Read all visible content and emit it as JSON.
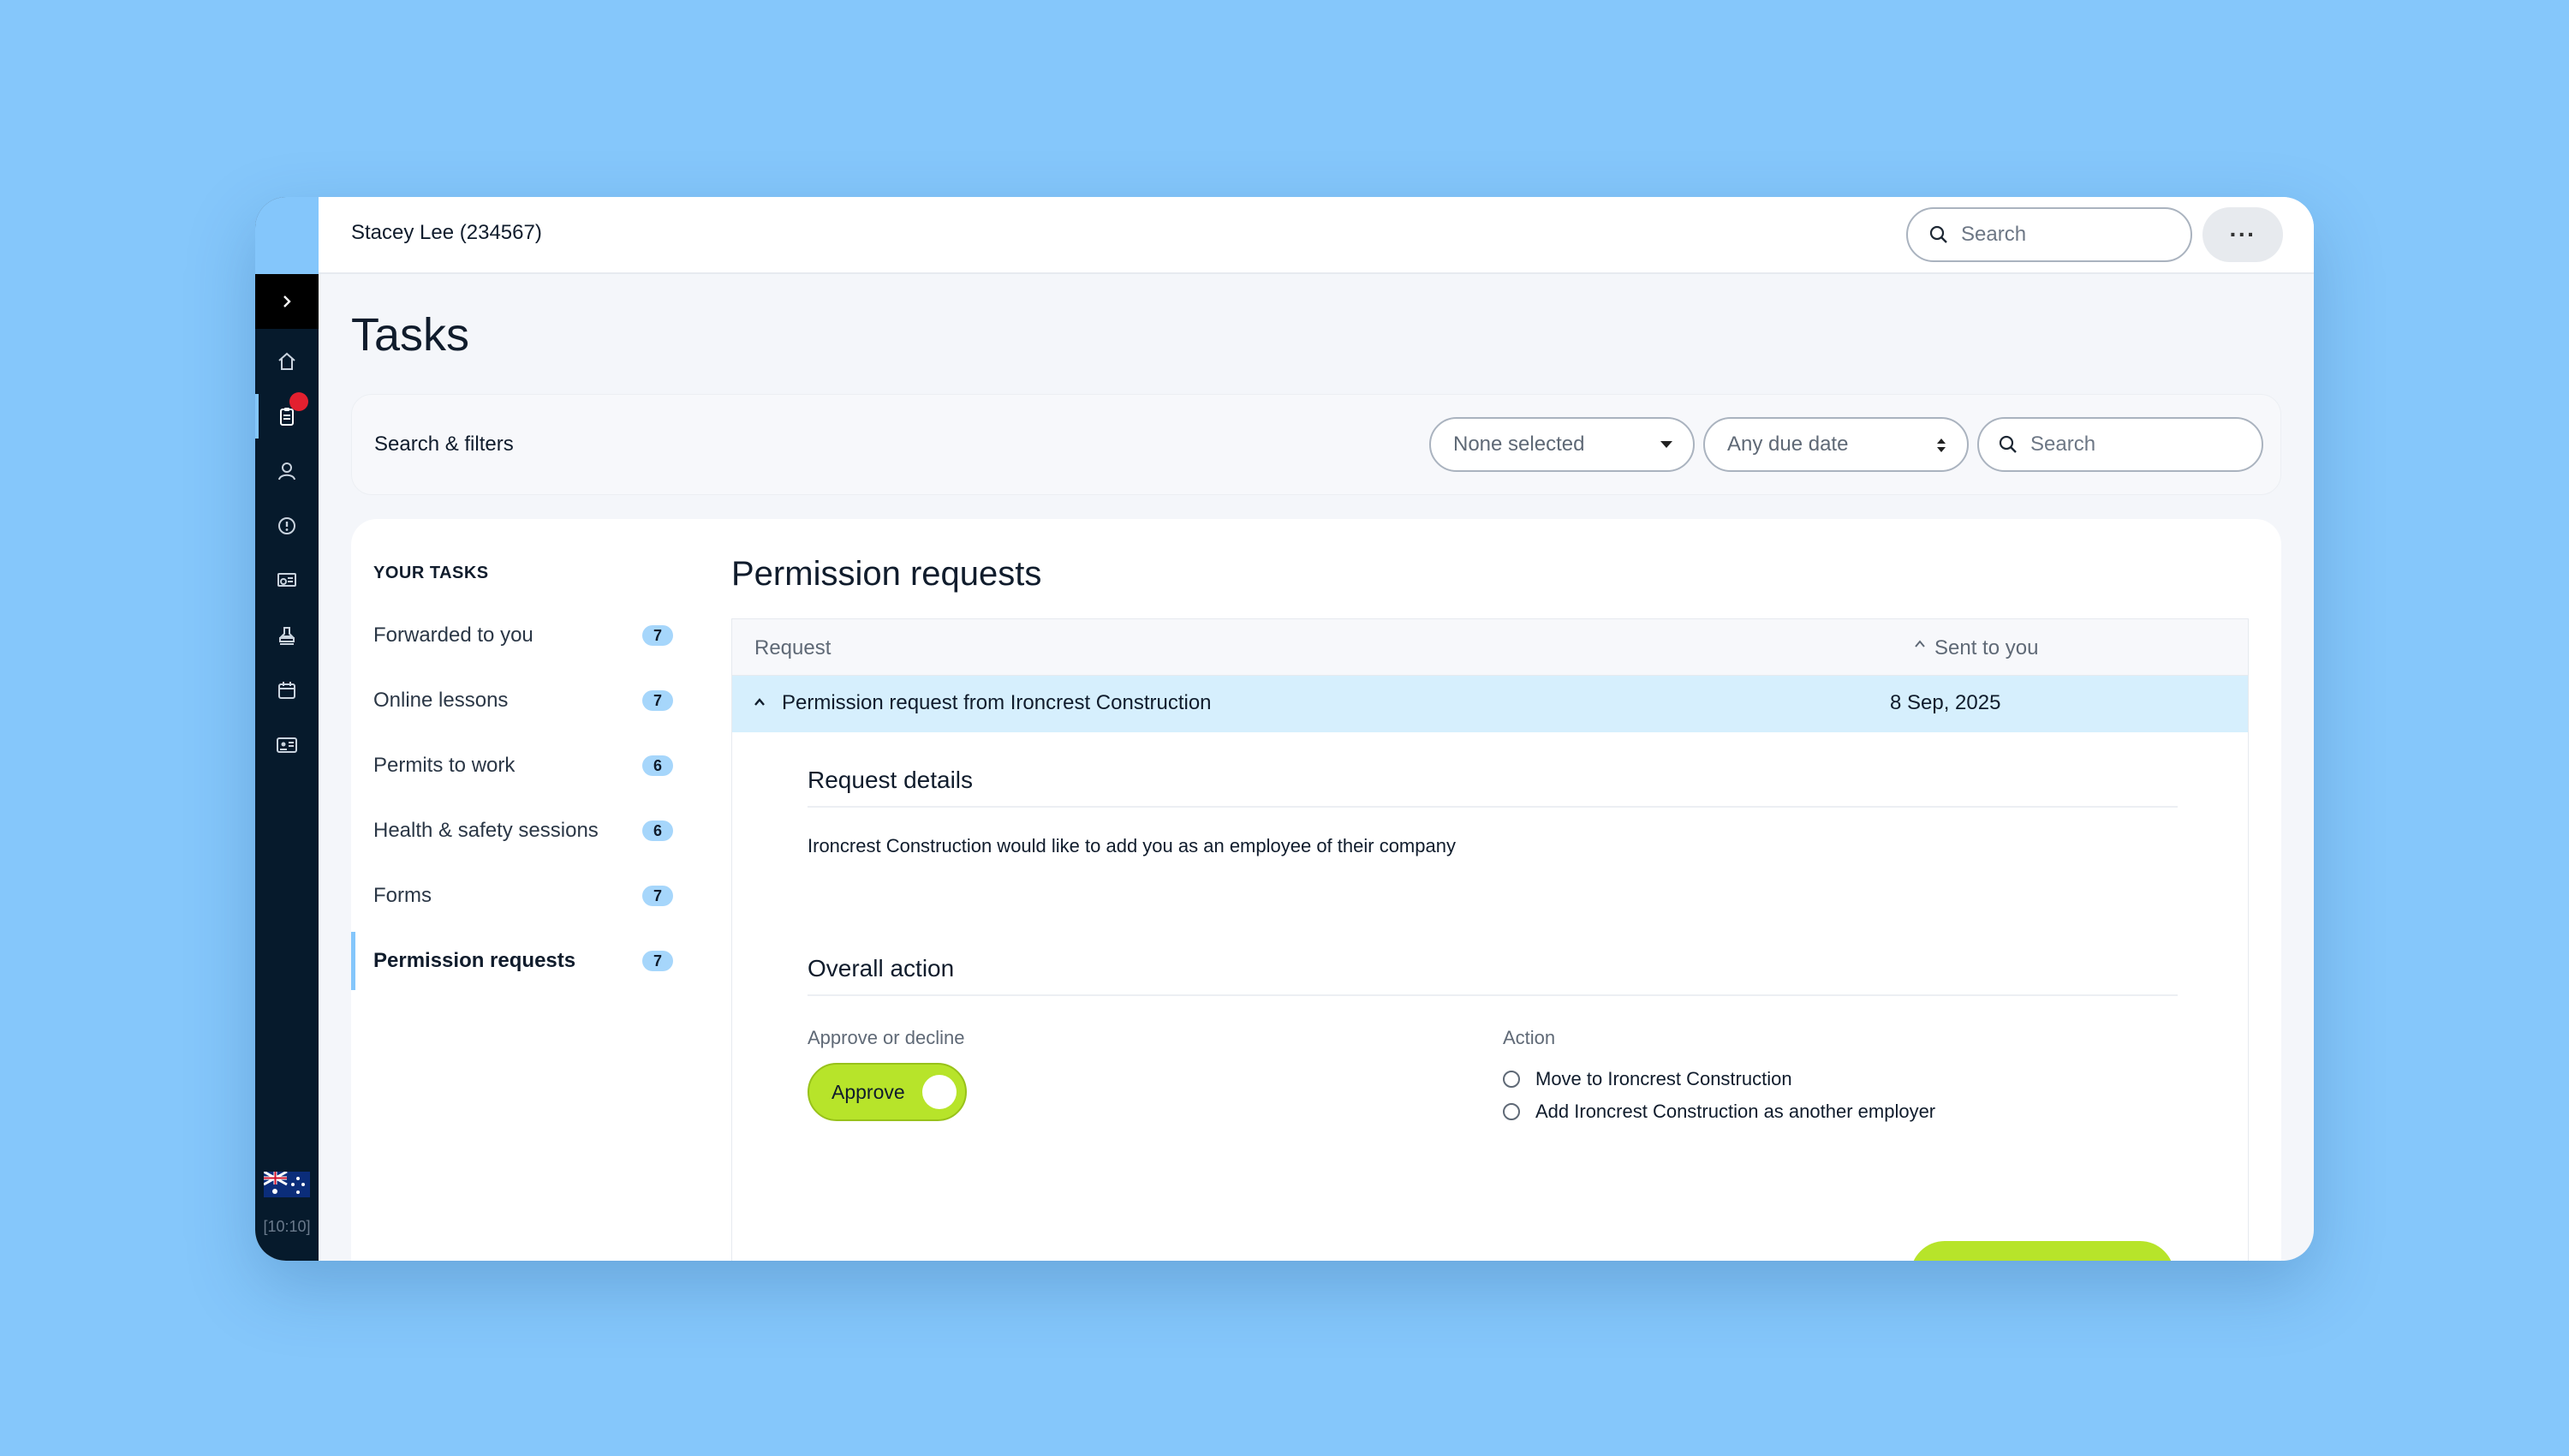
{
  "user": {
    "name": "Stacey Lee (234567)"
  },
  "topbar": {
    "search_placeholder": "Search",
    "more_label": "···"
  },
  "page": {
    "title": "Tasks"
  },
  "filters": {
    "label": "Search & filters",
    "status_select": "None selected",
    "due_date_select": "Any due date",
    "search_placeholder": "Search"
  },
  "sidebar": {
    "icons": [
      "home-icon",
      "clipboard-icon",
      "user-icon",
      "alert-icon",
      "certificate-icon",
      "stamp-icon",
      "calendar-icon",
      "id-card-icon"
    ],
    "active_index": 1,
    "flag": "australia-flag-icon",
    "clock": "[10:10]"
  },
  "tasks": {
    "heading": "YOUR TASKS",
    "items": [
      {
        "label": "Forwarded to you",
        "count": "7"
      },
      {
        "label": "Online lessons",
        "count": "7"
      },
      {
        "label": "Permits to work",
        "count": "6"
      },
      {
        "label": "Health & safety sessions",
        "count": "6"
      },
      {
        "label": "Forms",
        "count": "7"
      },
      {
        "label": "Permission requests",
        "count": "7"
      }
    ],
    "active_index": 5
  },
  "panel": {
    "title": "Permission requests",
    "columns": {
      "request": "Request",
      "sent": "Sent to you"
    },
    "row": {
      "title": "Permission request from Ironcrest Construction",
      "date": "8 Sep, 2025"
    },
    "details": {
      "title": "Request details",
      "text": "Ironcrest Construction would like to add you as an employee of their company"
    },
    "overall": {
      "title": "Overall action",
      "approve_label": "Approve or decline",
      "toggle_label": "Approve",
      "action_label": "Action",
      "options": [
        "Move to Ironcrest Construction",
        "Add Ironcrest Construction as another employer"
      ]
    }
  },
  "colors": {
    "background": "#85c7fb",
    "sidebar": "#061a2c",
    "accent_blue": "#84c6fb",
    "accent_green": "#b7e42a",
    "badge_red": "#e3202f",
    "row_highlight": "#d6effd"
  }
}
